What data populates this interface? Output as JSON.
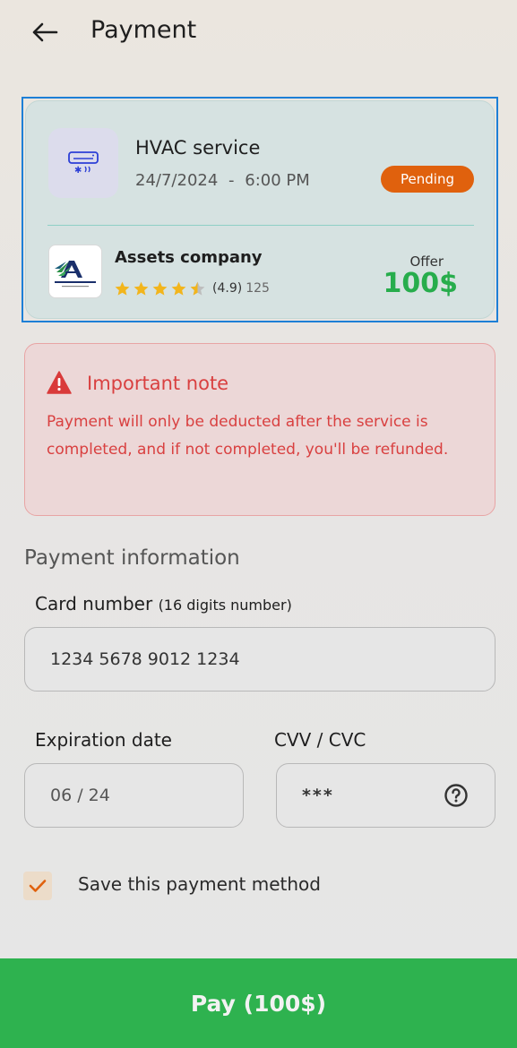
{
  "header": {
    "back_icon": "arrow-left-icon",
    "title": "Payment"
  },
  "service_card": {
    "service_icon": "air-conditioner-icon",
    "service_name": "HVAC service",
    "date": "24/7/2024",
    "date_separator": "-",
    "time": "6:00 PM",
    "status": "Pending",
    "status_color": "#e0610d",
    "company": {
      "name": "Assets company",
      "rating": 4.5,
      "rating_text": "(4.9)",
      "reviews_count": "125"
    },
    "offer_label": "Offer",
    "offer_price": "100$",
    "offer_color": "#27ad4c",
    "selection_color": "#1d7fd6"
  },
  "note": {
    "icon": "warning-triangle-icon",
    "title": "Important note",
    "text": "Payment will only be deducted after the service is completed, and if not completed, you'll be refunded.",
    "color": "#d94040"
  },
  "payment_info": {
    "section_title": "Payment information",
    "card_number_label": "Card number",
    "card_number_hint": "(16 digits number)",
    "card_number_value": "1234 5678 9012 1234",
    "expiration_label": "Expiration date",
    "expiration_value": "06 / 24",
    "cvv_label": "CVV / CVC",
    "cvv_value": "***",
    "cvv_help_icon": "question-circle-icon"
  },
  "save_method": {
    "checked": true,
    "label": "Save this payment method",
    "check_color": "#e0610d"
  },
  "pay_button": {
    "label": "Pay (100$)",
    "color": "#2eb24f"
  }
}
